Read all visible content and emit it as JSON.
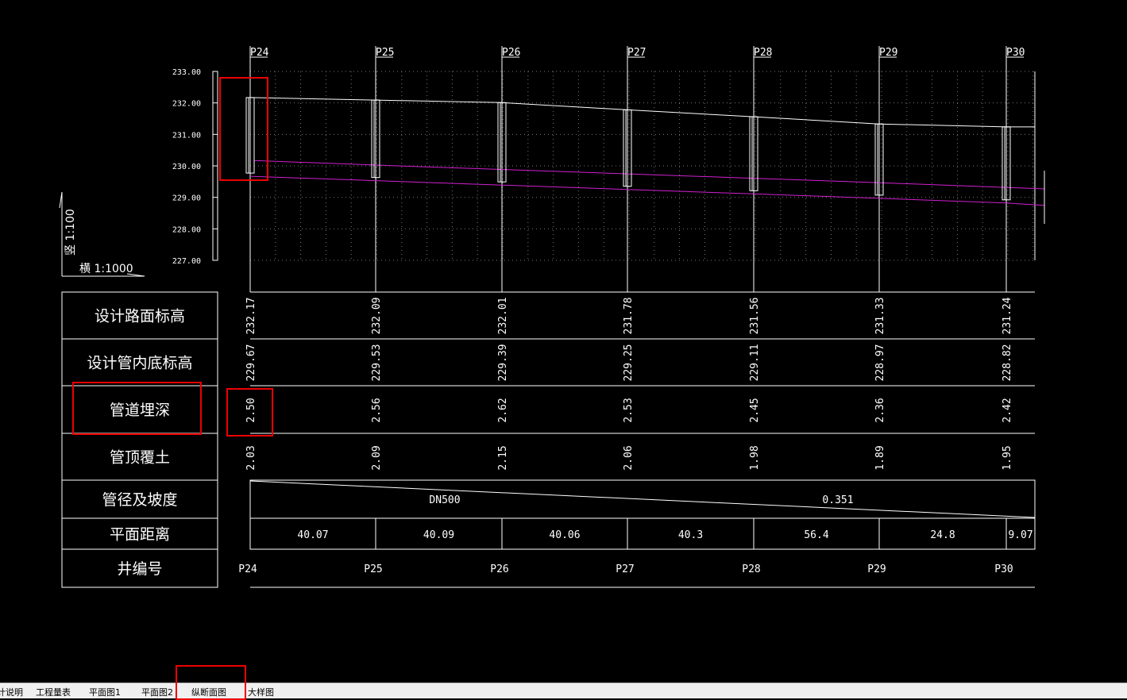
{
  "colors": {
    "background": "#000000",
    "line": "#ffffff",
    "grid": "#777777",
    "pipe": "#d020d0",
    "highlight": "#ee0000"
  },
  "scale": {
    "vertical": "竖 1:100",
    "horizontal": "横 1:1000"
  },
  "y_axis": {
    "ticks": [
      "233.00",
      "232.00",
      "231.00",
      "230.00",
      "229.00",
      "228.00",
      "227.00"
    ]
  },
  "wells": [
    "P24",
    "P25",
    "P26",
    "P27",
    "P28",
    "P29",
    "P30"
  ],
  "table": {
    "row_labels": [
      "设计路面标高",
      "设计管内底标高",
      "管道埋深",
      "管顶覆土",
      "管径及坡度",
      "平面距离",
      "井编号"
    ],
    "road_elevation": [
      "232.17",
      "232.09",
      "232.01",
      "231.78",
      "231.56",
      "231.33",
      "231.24"
    ],
    "invert_elevation": [
      "229.67",
      "229.53",
      "229.39",
      "229.25",
      "229.11",
      "228.97",
      "228.82"
    ],
    "burial_depth": [
      "2.50",
      "2.56",
      "2.62",
      "2.53",
      "2.45",
      "2.36",
      "2.42"
    ],
    "cover": [
      "2.03",
      "2.09",
      "2.15",
      "2.06",
      "1.98",
      "1.89",
      "1.95"
    ],
    "pipe_diameter": "DN500",
    "slope": "0.351",
    "distances": [
      "40.07",
      "40.09",
      "40.06",
      "40.3",
      "56.4",
      "24.8",
      "9.07"
    ],
    "well_ids": [
      "P24",
      "P25",
      "P26",
      "P27",
      "P28",
      "P29",
      "P30"
    ]
  },
  "tabs": [
    "计说明",
    "工程量表",
    "平面图1",
    "平面图2",
    "纵断面图",
    "大样图"
  ]
}
